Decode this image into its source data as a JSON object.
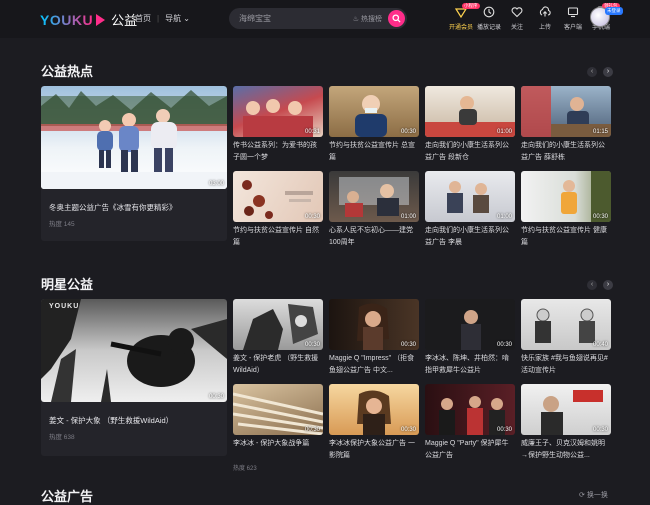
{
  "header": {
    "logo_text": "YOUKU",
    "logo_sub": "公益",
    "nav": [
      "首页",
      "导航"
    ],
    "search_placeholder": "海绵宝宝",
    "search_hot": "热搜榜",
    "icons": [
      {
        "icon": "vip-icon",
        "label": "开通会员",
        "tag": "小程序"
      },
      {
        "icon": "history-icon",
        "label": "播放记录",
        "tag": ""
      },
      {
        "icon": "heart-icon",
        "label": "关注",
        "tag": ""
      },
      {
        "icon": "upload-icon",
        "label": "上传",
        "tag": ""
      },
      {
        "icon": "client-icon",
        "label": "客户端",
        "tag": ""
      },
      {
        "icon": "phone-icon",
        "label": "手机端",
        "tag": "领礼包"
      }
    ],
    "avatar_badge": "未登录"
  },
  "sections": [
    {
      "title": "公益热点",
      "featured": {
        "title": "冬奥主题公益广告《冰雪有你更精彩》",
        "heat": "热度 145",
        "duration": "03:00"
      },
      "cards": [
        {
          "title": "传书公益系列：为爱书的孩子圆一个梦",
          "duration": "00:31",
          "heat": ""
        },
        {
          "title": "节约与扶贫公益宣传片 总宣篇",
          "duration": "00:30",
          "heat": ""
        },
        {
          "title": "走向我们的小康生活系列公益广告 段新仓",
          "duration": "01:00",
          "heat": ""
        },
        {
          "title": "走向我们的小康生活系列公益广告 薛舒栋",
          "duration": "01:15",
          "heat": ""
        },
        {
          "title": "节约与扶贫公益宣传片 自然篇",
          "duration": "00:30",
          "heat": ""
        },
        {
          "title": "心系人民不忘初心——建党100周年",
          "duration": "01:00",
          "heat": ""
        },
        {
          "title": "走向我们的小康生活系列公益广告 李晨",
          "duration": "01:00",
          "heat": ""
        },
        {
          "title": "节约与扶贫公益宣传片 健康篇",
          "duration": "00:30",
          "heat": ""
        }
      ]
    },
    {
      "title": "明星公益",
      "featured": {
        "title": "姜文 - 保护大象 （野生救援WildAid）",
        "heat": "热度 638",
        "duration": "00:30",
        "watermark": "YOUKU"
      },
      "cards": [
        {
          "title": "姜文 - 保护老虎 （野生救援WildAid）",
          "duration": "00:30",
          "heat": ""
        },
        {
          "title": "Maggie Q \"Impress\" （拒食鱼翅公益广告 中文...",
          "duration": "00:30",
          "heat": ""
        },
        {
          "title": "李冰冰、陈坤、井柏然：啃指甲救犀牛公益片",
          "duration": "00:30",
          "heat": ""
        },
        {
          "title": "快乐家族 #我与鱼翅说再见# 活动宣传片",
          "duration": "00:40",
          "heat": ""
        },
        {
          "title": "李冰冰 - 保护大象战争篇",
          "duration": "00:30",
          "heat": "热度 623"
        },
        {
          "title": "李冰冰保护大象公益广告 一影院篇",
          "duration": "00:30",
          "heat": ""
        },
        {
          "title": "Maggie Q \"Party\" 保护犀牛公益广告",
          "duration": "00:30",
          "heat": ""
        },
        {
          "title": "威廉王子、贝克汉姆和姚明→保护野生动物公益...",
          "duration": "00:30",
          "heat": ""
        }
      ]
    },
    {
      "title": "公益广告",
      "refresh": "换一换"
    }
  ]
}
